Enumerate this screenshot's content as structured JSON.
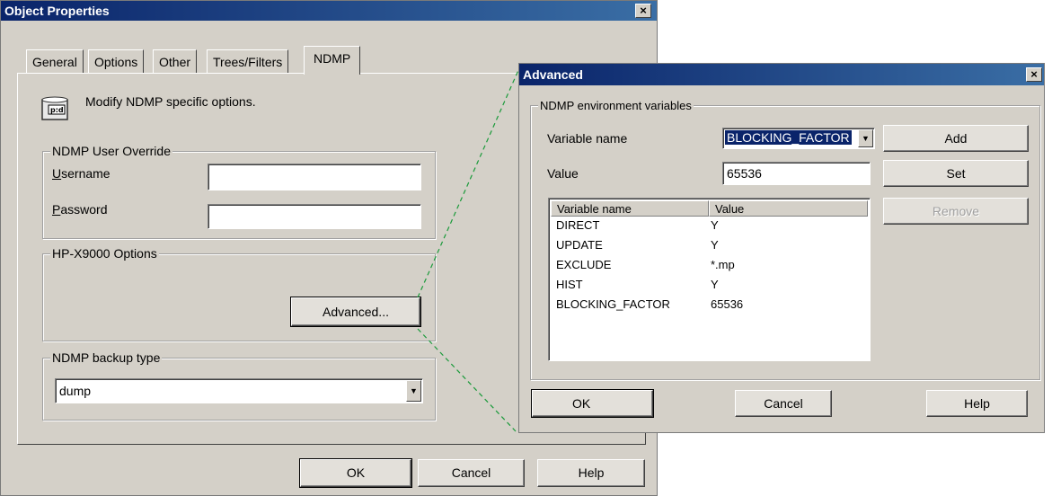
{
  "object_properties": {
    "title": "Object Properties",
    "close_glyph": "×",
    "tabs": [
      "General",
      "Options",
      "Other",
      "Trees/Filters",
      "NDMP"
    ],
    "description": "Modify NDMP specific options.",
    "user_override": {
      "group_label": "NDMP User Override",
      "username_label": "Username",
      "username_accel": "U",
      "username_rest": "sername",
      "password_label": "Password",
      "password_accel": "P",
      "password_rest": "assword",
      "username_value": "",
      "password_value": ""
    },
    "hp_options": {
      "group_label": "HP-X9000 Options",
      "advanced_button": "Advanced..."
    },
    "backup_type": {
      "group_label": "NDMP backup type",
      "selected": "dump"
    },
    "buttons": {
      "ok": "OK",
      "cancel": "Cancel",
      "help": "Help"
    }
  },
  "advanced": {
    "title": "Advanced",
    "close_glyph": "×",
    "group_label": "NDMP environment variables",
    "variable_name_label": "Variable name",
    "variable_name_selected": "BLOCKING_FACTOR",
    "value_label": "Value",
    "value_input": "65536",
    "buttons": {
      "add": "Add",
      "set": "Set",
      "remove": "Remove",
      "ok": "OK",
      "cancel": "Cancel",
      "help": "Help"
    },
    "list_columns": [
      "Variable name",
      "Value"
    ],
    "list_rows": [
      [
        "DIRECT",
        "Y"
      ],
      [
        "UPDATE",
        "Y"
      ],
      [
        "EXCLUDE",
        "*.mp"
      ],
      [
        "HIST",
        "Y"
      ],
      [
        "BLOCKING_FACTOR",
        "65536"
      ]
    ]
  },
  "colors": {
    "titlebar": "#0a246a",
    "dialog_face": "#d4d0c8",
    "connector": "#1a9a3a"
  }
}
